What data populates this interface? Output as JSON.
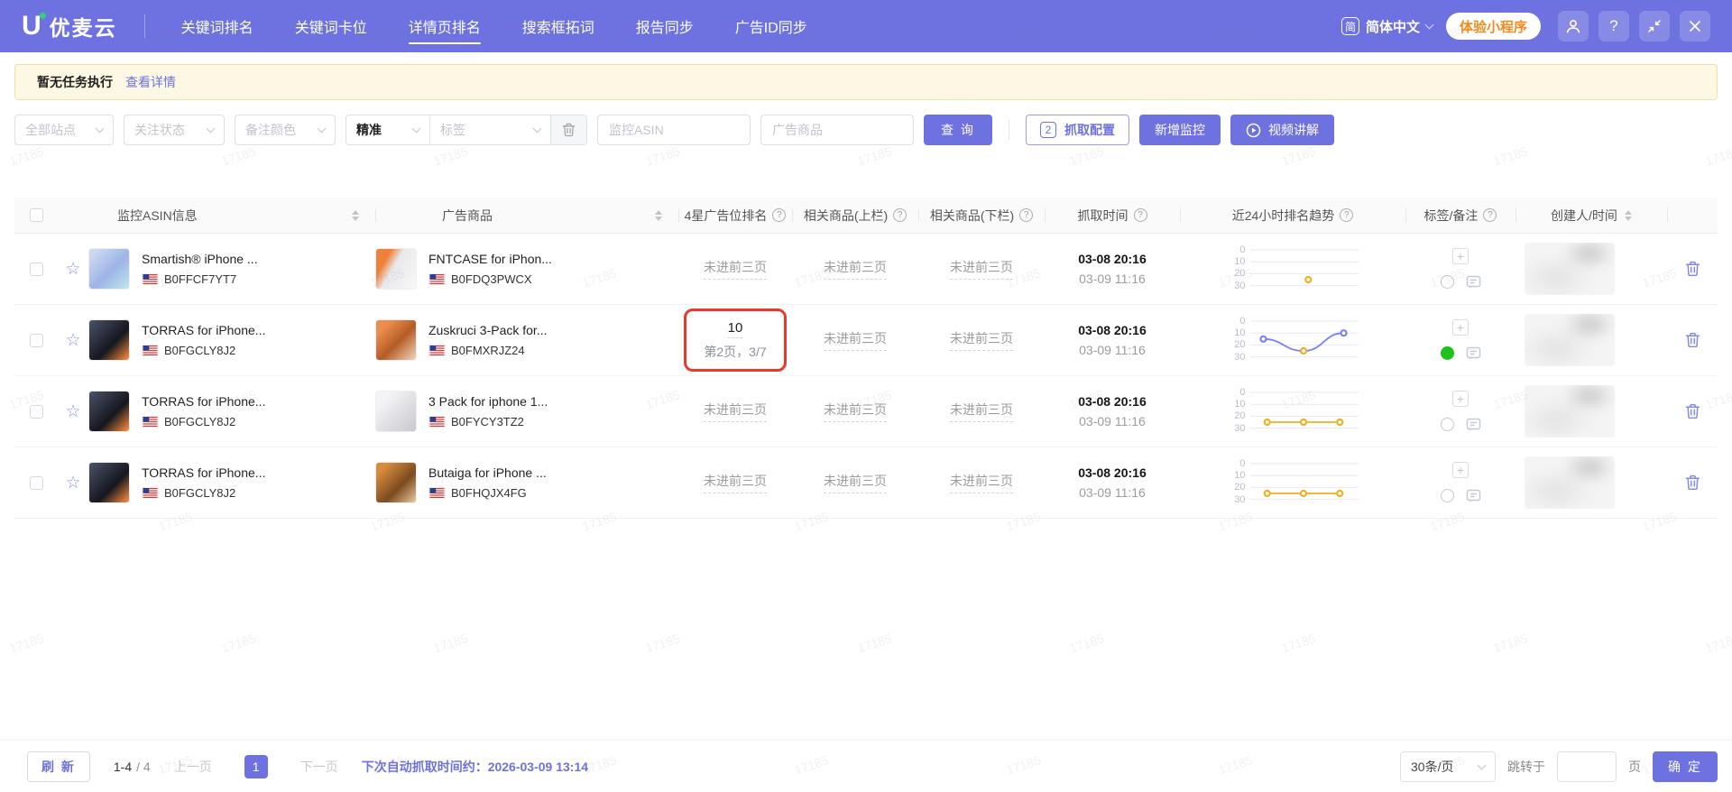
{
  "navbar": {
    "logo_text": "优麦云",
    "menu": [
      {
        "label": "关键词排名",
        "active": false
      },
      {
        "label": "关键词卡位",
        "active": false
      },
      {
        "label": "详情页排名",
        "active": true
      },
      {
        "label": "搜索框拓词",
        "active": false
      },
      {
        "label": "报告同步",
        "active": false
      },
      {
        "label": "广告ID同步",
        "active": false
      }
    ],
    "language": {
      "icon": "简",
      "label": "简体中文"
    },
    "mini_program_label": "体验小程序"
  },
  "icons": {
    "help_glyph": "?",
    "plus_glyph": "+",
    "star_glyph": "☆"
  },
  "notice": {
    "text": "暂无任务执行",
    "link": "查看详情"
  },
  "filters": {
    "site_placeholder": "全部站点",
    "follow_status_placeholder": "关注状态",
    "note_color_placeholder": "备注颜色",
    "match_type_value": "精准",
    "tag_placeholder": "标签",
    "asin_placeholder": "监控ASIN",
    "ad_product_placeholder": "广告商品",
    "search_button": "查 询",
    "capture_config_badge": "2",
    "capture_config_button": "抓取配置",
    "add_monitor_button": "新增监控",
    "video_button": "视频讲解"
  },
  "table": {
    "columns": [
      {
        "key": "asin",
        "label": "监控ASIN信息",
        "sort": true
      },
      {
        "key": "ad",
        "label": "广告商品",
        "sort": true
      },
      {
        "key": "rank",
        "label": "4星广告位排名",
        "info": true
      },
      {
        "key": "rel_top",
        "label": "相关商品(上栏)",
        "info": true
      },
      {
        "key": "rel_bot",
        "label": "相关商品(下栏)",
        "info": true
      },
      {
        "key": "time",
        "label": "抓取时间",
        "info": true
      },
      {
        "key": "trend",
        "label": "近24小时排名趋势",
        "info": true
      },
      {
        "key": "tags",
        "label": "标签/备注",
        "info": true
      },
      {
        "key": "creator",
        "label": "创建人/时间",
        "sort": true
      }
    ],
    "rows": [
      {
        "asin": {
          "title": "Smartish® iPhone ...",
          "code": "B0FFCF7YT7",
          "img": "smartish"
        },
        "ad": {
          "title": "FNTCASE for iPhon...",
          "code": "B0FDQ3PWCX",
          "img": "fntcase"
        },
        "rank": {
          "text": "未进前三页"
        },
        "rel_top": "未进前三页",
        "rel_bot": "未进前三页",
        "time": [
          "03-08 20:16",
          "03-09 11:16"
        ],
        "trend": {
          "axis": [
            0,
            10,
            20,
            30
          ],
          "line_color": null,
          "points": [
            {
              "pos": 0.55,
              "rank": 25,
              "color": "#efb022"
            }
          ]
        },
        "note_color": null,
        "creator_redacted": true
      },
      {
        "asin": {
          "title": "TORRAS for iPhone...",
          "code": "B0FGCLY8J2",
          "img": "torras"
        },
        "ad": {
          "title": "Zuskruci 3-Pack for...",
          "code": "B0FMXRJZ24",
          "img": "zuskruci"
        },
        "rank": {
          "value": "10",
          "detail": "第2页，3/7",
          "highlighted": true
        },
        "rel_top": "未进前三页",
        "rel_bot": "未进前三页",
        "time": [
          "03-08 20:16",
          "03-09 11:16"
        ],
        "trend": {
          "axis": [
            0,
            10,
            20,
            30
          ],
          "line_color": "#7b7ff2",
          "points": [
            {
              "pos": 0.08,
              "rank": 15,
              "color": "#7b7ff2"
            },
            {
              "pos": 0.5,
              "rank": 25,
              "color": "#efb022"
            },
            {
              "pos": 0.92,
              "rank": 10,
              "color": "#7b7ff2"
            }
          ]
        },
        "note_color": "#1fc11f",
        "creator_redacted": true
      },
      {
        "asin": {
          "title": "TORRAS for iPhone...",
          "code": "B0FGCLY8J2",
          "img": "torras"
        },
        "ad": {
          "title": "3 Pack for iphone 1...",
          "code": "B0FYCY3TZ2",
          "img": "3pack"
        },
        "rank": {
          "text": "未进前三页"
        },
        "rel_top": "未进前三页",
        "rel_bot": "未进前三页",
        "time": [
          "03-08 20:16",
          "03-09 11:16"
        ],
        "trend": {
          "axis": [
            0,
            10,
            20,
            30
          ],
          "line_color": "#efb022",
          "points": [
            {
              "pos": 0.12,
              "rank": 25,
              "color": "#efb022"
            },
            {
              "pos": 0.5,
              "rank": 25,
              "color": "#efb022"
            },
            {
              "pos": 0.88,
              "rank": 25,
              "color": "#efb022"
            }
          ]
        },
        "note_color": null,
        "creator_redacted": true
      },
      {
        "asin": {
          "title": "TORRAS for iPhone...",
          "code": "B0FGCLY8J2",
          "img": "torras"
        },
        "ad": {
          "title": "Butaiga for iPhone ...",
          "code": "B0FHQJX4FG",
          "img": "butaiga"
        },
        "rank": {
          "text": "未进前三页"
        },
        "rel_top": "未进前三页",
        "rel_bot": "未进前三页",
        "time": [
          "03-08 20:16",
          "03-09 11:16"
        ],
        "trend": {
          "axis": [
            0,
            10,
            20,
            30
          ],
          "line_color": "#efb022",
          "points": [
            {
              "pos": 0.12,
              "rank": 25,
              "color": "#efb022"
            },
            {
              "pos": 0.5,
              "rank": 25,
              "color": "#efb022"
            },
            {
              "pos": 0.88,
              "rank": 25,
              "color": "#efb022"
            }
          ]
        },
        "note_color": null,
        "creator_redacted": true
      }
    ]
  },
  "pagination": {
    "refresh": "刷 新",
    "range": "1-4",
    "total": "/ 4",
    "prev": "上一页",
    "page": "1",
    "next": "下一页",
    "next_capture_label": "下次自动抓取时间约：",
    "next_capture_time": "2026-03-09 13:14",
    "page_size": "30条/页",
    "jump_label": "跳转于",
    "page_unit": "页",
    "confirm": "确 定"
  },
  "watermark": {
    "text": "17185"
  },
  "colors": {
    "primary": "#6e72e1",
    "highlight_red": "#e73a2c",
    "note_green": "#1fc11f",
    "trend_yellow": "#efb022",
    "trend_purple": "#7b7ff2",
    "notice_bg": "#fdf8e3",
    "mini_program_orange": "#f28a1e"
  }
}
